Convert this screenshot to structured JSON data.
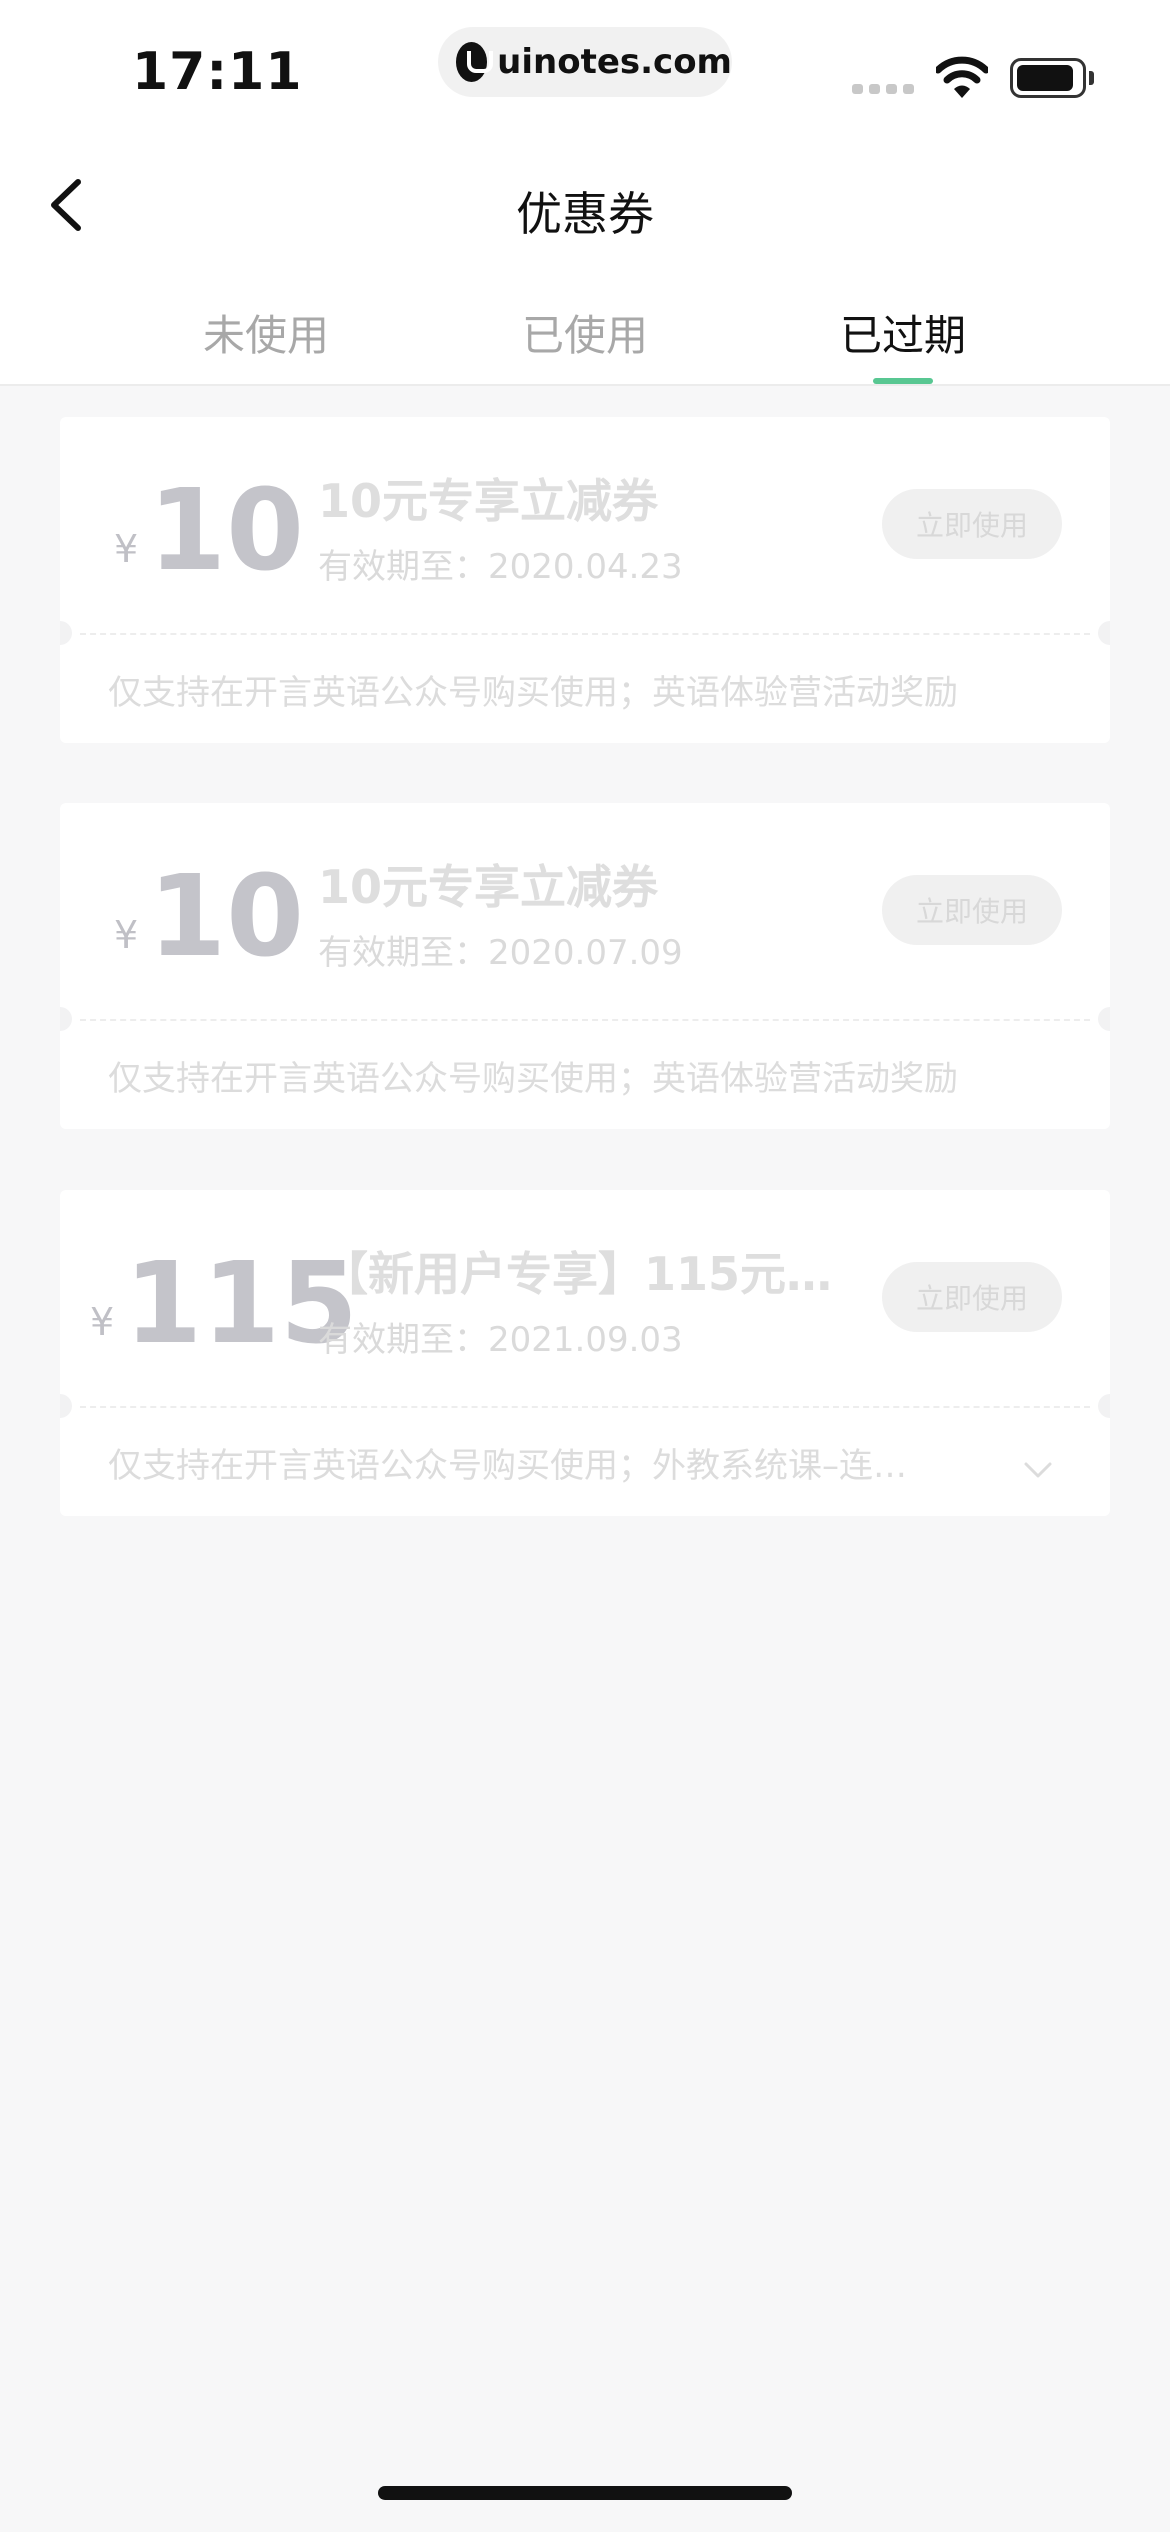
{
  "status_bar": {
    "time": "17:11",
    "site": "uinotes.com"
  },
  "nav": {
    "title": "优惠券",
    "back_icon": "chevron-left-icon"
  },
  "tabs": [
    {
      "label": "未使用",
      "active": false
    },
    {
      "label": "已使用",
      "active": false
    },
    {
      "label": "已过期",
      "active": true
    }
  ],
  "colors": {
    "accent": "#58c792",
    "background": "#f7f7f8",
    "amount": "#c4c4ca"
  },
  "coupons": [
    {
      "currency": "¥",
      "amount": "10",
      "title": "10元专享立减券",
      "expiry": "有效期至：2020.04.23",
      "button": "立即使用",
      "description": "仅支持在开言英语公众号购买使用；英语体验营活动奖励",
      "expandable": false
    },
    {
      "currency": "¥",
      "amount": "10",
      "title": "10元专享立减券",
      "expiry": "有效期至：2020.07.09",
      "button": "立即使用",
      "description": "仅支持在开言英语公众号购买使用；英语体验营活动奖励",
      "expandable": false
    },
    {
      "currency": "¥",
      "amount": "115",
      "title": "【新用户专享】115元…",
      "expiry": "有效期至：2021.09.03",
      "button": "立即使用",
      "description": "仅支持在开言英语公众号购买使用；外教系统课–连…",
      "expandable": true,
      "expand_icon": "chevron-down-icon"
    }
  ]
}
